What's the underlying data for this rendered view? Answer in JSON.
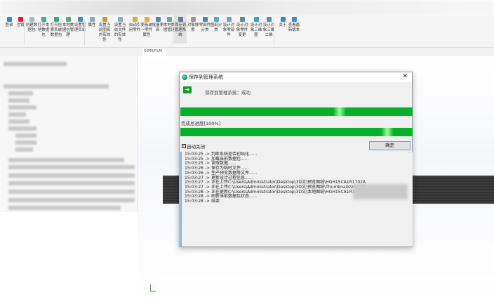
{
  "toolbar": {
    "items": [
      {
        "label": "登录",
        "color": "#2a8ad4"
      },
      {
        "label": "注销",
        "color": "#d22"
      },
      {
        "label": "创建数据包",
        "color": "#9bc"
      },
      {
        "label": "打开本地数据包",
        "color": "#4a9"
      },
      {
        "label": "打开检索系统数据包",
        "color": "#3a7"
      },
      {
        "label": "本地数据包管理",
        "color": "#5a8"
      },
      {
        "label": "设置管理目录",
        "color": "#48c"
      },
      {
        "label": "属性",
        "color": "#8ac"
      },
      {
        "label": "设置当前图纸的有效性",
        "color": "#c93"
      },
      {
        "label": "设置当前文件的有效性",
        "color": "#8ac"
      },
      {
        "label": "自动引用零件",
        "color": "#da3"
      },
      {
        "label": "更新统一零件属性",
        "color": "#ea3"
      },
      {
        "label": "批量更新",
        "color": "#58a"
      },
      {
        "label": "本地数据管理",
        "color": "#6a9"
      },
      {
        "label": "保存到管理系统",
        "color": "#679"
      },
      {
        "label": "对象搜索",
        "color": "#999"
      },
      {
        "label": "零部件分类",
        "color": "#48a"
      },
      {
        "label": "图纸分类",
        "color": "#5ac"
      },
      {
        "label": "设计对象零部件",
        "color": "#6ac"
      },
      {
        "label": "设计对象零件变更",
        "color": "#689"
      },
      {
        "label": "设计对象三维图",
        "color": "#49c"
      },
      {
        "label": "设计对象三维二维",
        "color": "#68a"
      },
      {
        "label": "关于",
        "color": "#38c"
      },
      {
        "label": "查看最新版本",
        "color": "#48c"
      }
    ]
  },
  "tab": "SIPM/PLM",
  "dialog": {
    "title": "保存到管理系统",
    "status": "保存到管理系统：成功",
    "progress_label": "完成总进度[100%]",
    "progress1": 100,
    "progress2": 100,
    "checkbox_label": "自动关闭",
    "checkbox_checked": true,
    "ok_label": "确定",
    "log": [
      "15:03:25 -> 判断系统是否初始化......",
      "15:03:25 -> 加载当前数据包......",
      "15:03:25 -> 读取数据......",
      "15:03:26 -> 保存为临时文件......",
      "15:03:26 -> 生产预览数据等文件......",
      "15:03:27 -> 更新设计过程信息......",
      "15:03:27 -> 正在上传C:\\Users\\Administrator\\Desktop\\3D文\\预览图纸\\HGH15CA1R1702A",
      "15:03:27 -> 正在上传C:\\Users\\Administrator\\Desktop\\3D文\\预览图纸\\Thumbnails\\HGH15",
      "15:03:28 -> 正在更新C:\\Users\\Administrator\\Desktop\\3D文\\本地图纸\\HGH15CA1R1702A",
      "15:03:28 -> 刷新当前数据包状态......",
      "15:03:28 -> 结束"
    ]
  }
}
